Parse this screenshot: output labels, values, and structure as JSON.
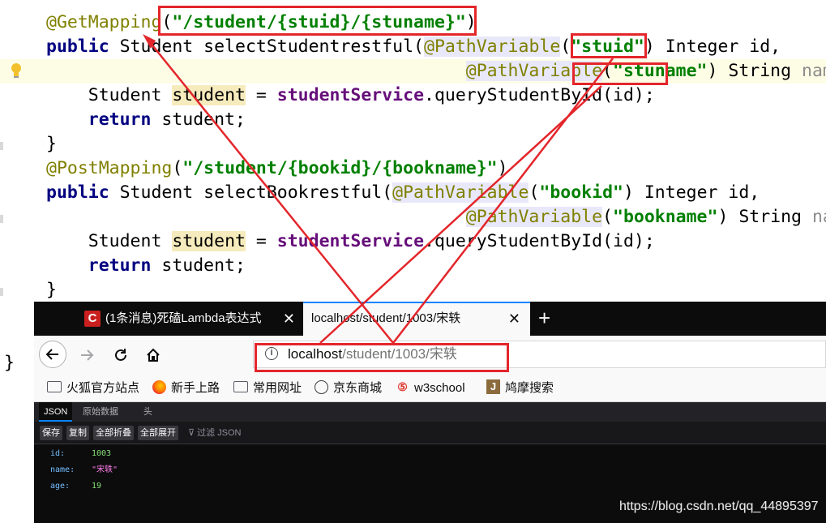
{
  "code": {
    "lines": [
      {
        "tokens": [
          {
            "t": "@GetMapping",
            "c": "ann"
          },
          {
            "t": "(",
            "c": ""
          },
          {
            "t": "\"/student/{stuid}/{stuname}\"",
            "c": "str"
          },
          {
            "t": ")",
            "c": ""
          }
        ]
      },
      {
        "tokens": [
          {
            "t": "public",
            "c": "kw"
          },
          {
            "t": " Student selectStudentrestful(",
            "c": ""
          },
          {
            "t": "@PathVariable",
            "c": "ann hl-ann"
          },
          {
            "t": "(",
            "c": ""
          },
          {
            "t": "\"stuid\"",
            "c": "str"
          },
          {
            "t": ") Integer id,",
            "c": ""
          }
        ]
      },
      {
        "tokens": [
          {
            "t": "                                        ",
            "c": ""
          },
          {
            "t": "@PathVariable",
            "c": "ann hl-ann"
          },
          {
            "t": "(",
            "c": ""
          },
          {
            "t": "\"stuname\"",
            "c": "str"
          },
          {
            "t": ") String ",
            "c": ""
          },
          {
            "t": "name",
            "c": "param"
          },
          {
            "t": "){",
            "c": ""
          }
        ]
      },
      {
        "tokens": [
          {
            "t": "    Student ",
            "c": ""
          },
          {
            "t": "student",
            "c": "hl-var"
          },
          {
            "t": " = ",
            "c": ""
          },
          {
            "t": "studentService",
            "c": "fld"
          },
          {
            "t": ".queryStudentById(id);",
            "c": ""
          }
        ]
      },
      {
        "tokens": [
          {
            "t": "    ",
            "c": ""
          },
          {
            "t": "return",
            "c": "kw"
          },
          {
            "t": " student;",
            "c": ""
          }
        ]
      },
      {
        "tokens": [
          {
            "t": "}",
            "c": ""
          }
        ]
      },
      {
        "tokens": [
          {
            "t": "@PostMapping",
            "c": "ann"
          },
          {
            "t": "(",
            "c": ""
          },
          {
            "t": "\"/student/{bookid}/{bookname}\"",
            "c": "str"
          },
          {
            "t": ")",
            "c": ""
          }
        ]
      },
      {
        "tokens": [
          {
            "t": "public",
            "c": "kw"
          },
          {
            "t": " Student selectBookrestful(",
            "c": ""
          },
          {
            "t": "@PathVariable",
            "c": "ann hl-ann"
          },
          {
            "t": "(",
            "c": ""
          },
          {
            "t": "\"bookid\"",
            "c": "str"
          },
          {
            "t": ") Integer id,",
            "c": ""
          }
        ]
      },
      {
        "tokens": [
          {
            "t": "                                        ",
            "c": ""
          },
          {
            "t": "@PathVariable",
            "c": "ann hl-ann"
          },
          {
            "t": "(",
            "c": ""
          },
          {
            "t": "\"bookname\"",
            "c": "str"
          },
          {
            "t": ") String ",
            "c": ""
          },
          {
            "t": "name",
            "c": "param"
          },
          {
            "t": ")",
            "c": ""
          }
        ]
      },
      {
        "tokens": [
          {
            "t": "    Student ",
            "c": ""
          },
          {
            "t": "student",
            "c": "hl-var"
          },
          {
            "t": " = ",
            "c": ""
          },
          {
            "t": "studentService",
            "c": "fld"
          },
          {
            "t": ".queryStudentById(id);",
            "c": ""
          }
        ]
      },
      {
        "tokens": [
          {
            "t": "    ",
            "c": ""
          },
          {
            "t": "return",
            "c": "kw"
          },
          {
            "t": " student;",
            "c": ""
          }
        ]
      },
      {
        "tokens": [
          {
            "t": "}",
            "c": ""
          }
        ]
      }
    ],
    "closing_brace": "}"
  },
  "browser": {
    "tabs": [
      {
        "label": "(1条消息)死磕Lambda表达式",
        "favicon": "C",
        "close": "✕"
      },
      {
        "label": "localhost/student/1003/宋轶",
        "close": "✕"
      }
    ],
    "new_tab": "+",
    "url": {
      "host": "localhost",
      "path": "/student/1003/宋轶"
    },
    "bookmarks": [
      {
        "label": "火狐官方站点",
        "icon": "folder-icon"
      },
      {
        "label": "新手上路",
        "icon": "firefox-icon"
      },
      {
        "label": "常用网址",
        "icon": "folder-icon"
      },
      {
        "label": "京东商城",
        "icon": "globe-icon"
      },
      {
        "label": "w3school",
        "icon": "w3-icon"
      },
      {
        "label": "鸠摩搜索",
        "icon": "j-icon"
      }
    ],
    "viewer": {
      "tabs": [
        "JSON",
        "原始数据",
        "头"
      ],
      "buttons": [
        "保存",
        "复制",
        "全部折叠",
        "全部展开"
      ],
      "filter_placeholder": "过滤 JSON",
      "rows": [
        {
          "key": "id:",
          "value": "1003",
          "type": "num"
        },
        {
          "key": "name:",
          "value": "\"宋轶\"",
          "type": "str"
        },
        {
          "key": "age:",
          "value": "19",
          "type": "num"
        }
      ]
    }
  },
  "watermark": "https://blog.csdn.net/qq_44895397",
  "colors": {
    "annotation_red": "#e3262b",
    "annotation": "#808000",
    "keyword": "#000080",
    "string": "#008000",
    "field": "#660e7a"
  }
}
